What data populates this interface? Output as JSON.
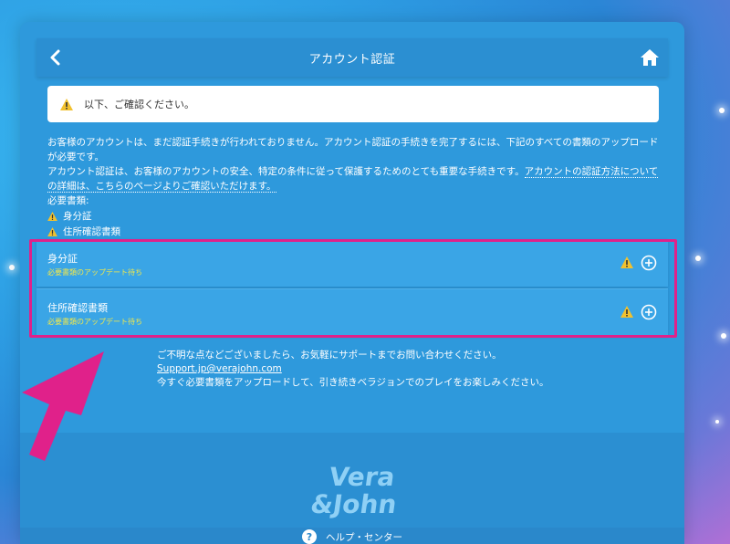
{
  "header": {
    "title": "アカウント認証",
    "back_icon": "chevron-left-icon",
    "home_icon": "home-icon"
  },
  "notice": {
    "text": "以下、ご確認ください。",
    "icon": "warning-icon"
  },
  "intro": {
    "line1": "お客様のアカウントは、まだ認証手続きが行われておりません。アカウント認証の手続きを完了するには、下記のすべての書類のアップロードが必要です。",
    "line2_prefix": "アカウント認証は、お客様のアカウントの安全、特定の条件に従って保護するためのとても重要な手続きです。",
    "line2_link": "アカウントの認証方法についての詳細は、こちらのページよりご確認いただけます。",
    "required_label": "必要書類:",
    "required_items": [
      "身分証",
      "住所確認書類"
    ]
  },
  "documents": [
    {
      "name": "身分証",
      "status": "必要書類のアップデート待ち"
    },
    {
      "name": "住所確認書類",
      "status": "必要書類のアップデート待ち"
    }
  ],
  "contact": {
    "line1": "ご不明な点などございましたら、お気軽にサポートまでお問い合わせください。",
    "email": "Support.jp@verajohn.com",
    "line2": "今すぐ必要書類をアップロードして、引き続きベラジョンでのプレイをお楽しみください。"
  },
  "footer": {
    "logo_text_1": "Vera",
    "logo_text_2": "&John",
    "help_label": "ヘルプ・センター"
  },
  "colors": {
    "accent_pink": "#e0218a",
    "status_yellow": "#f2e84a",
    "panel_blue": "#2e99dc"
  }
}
